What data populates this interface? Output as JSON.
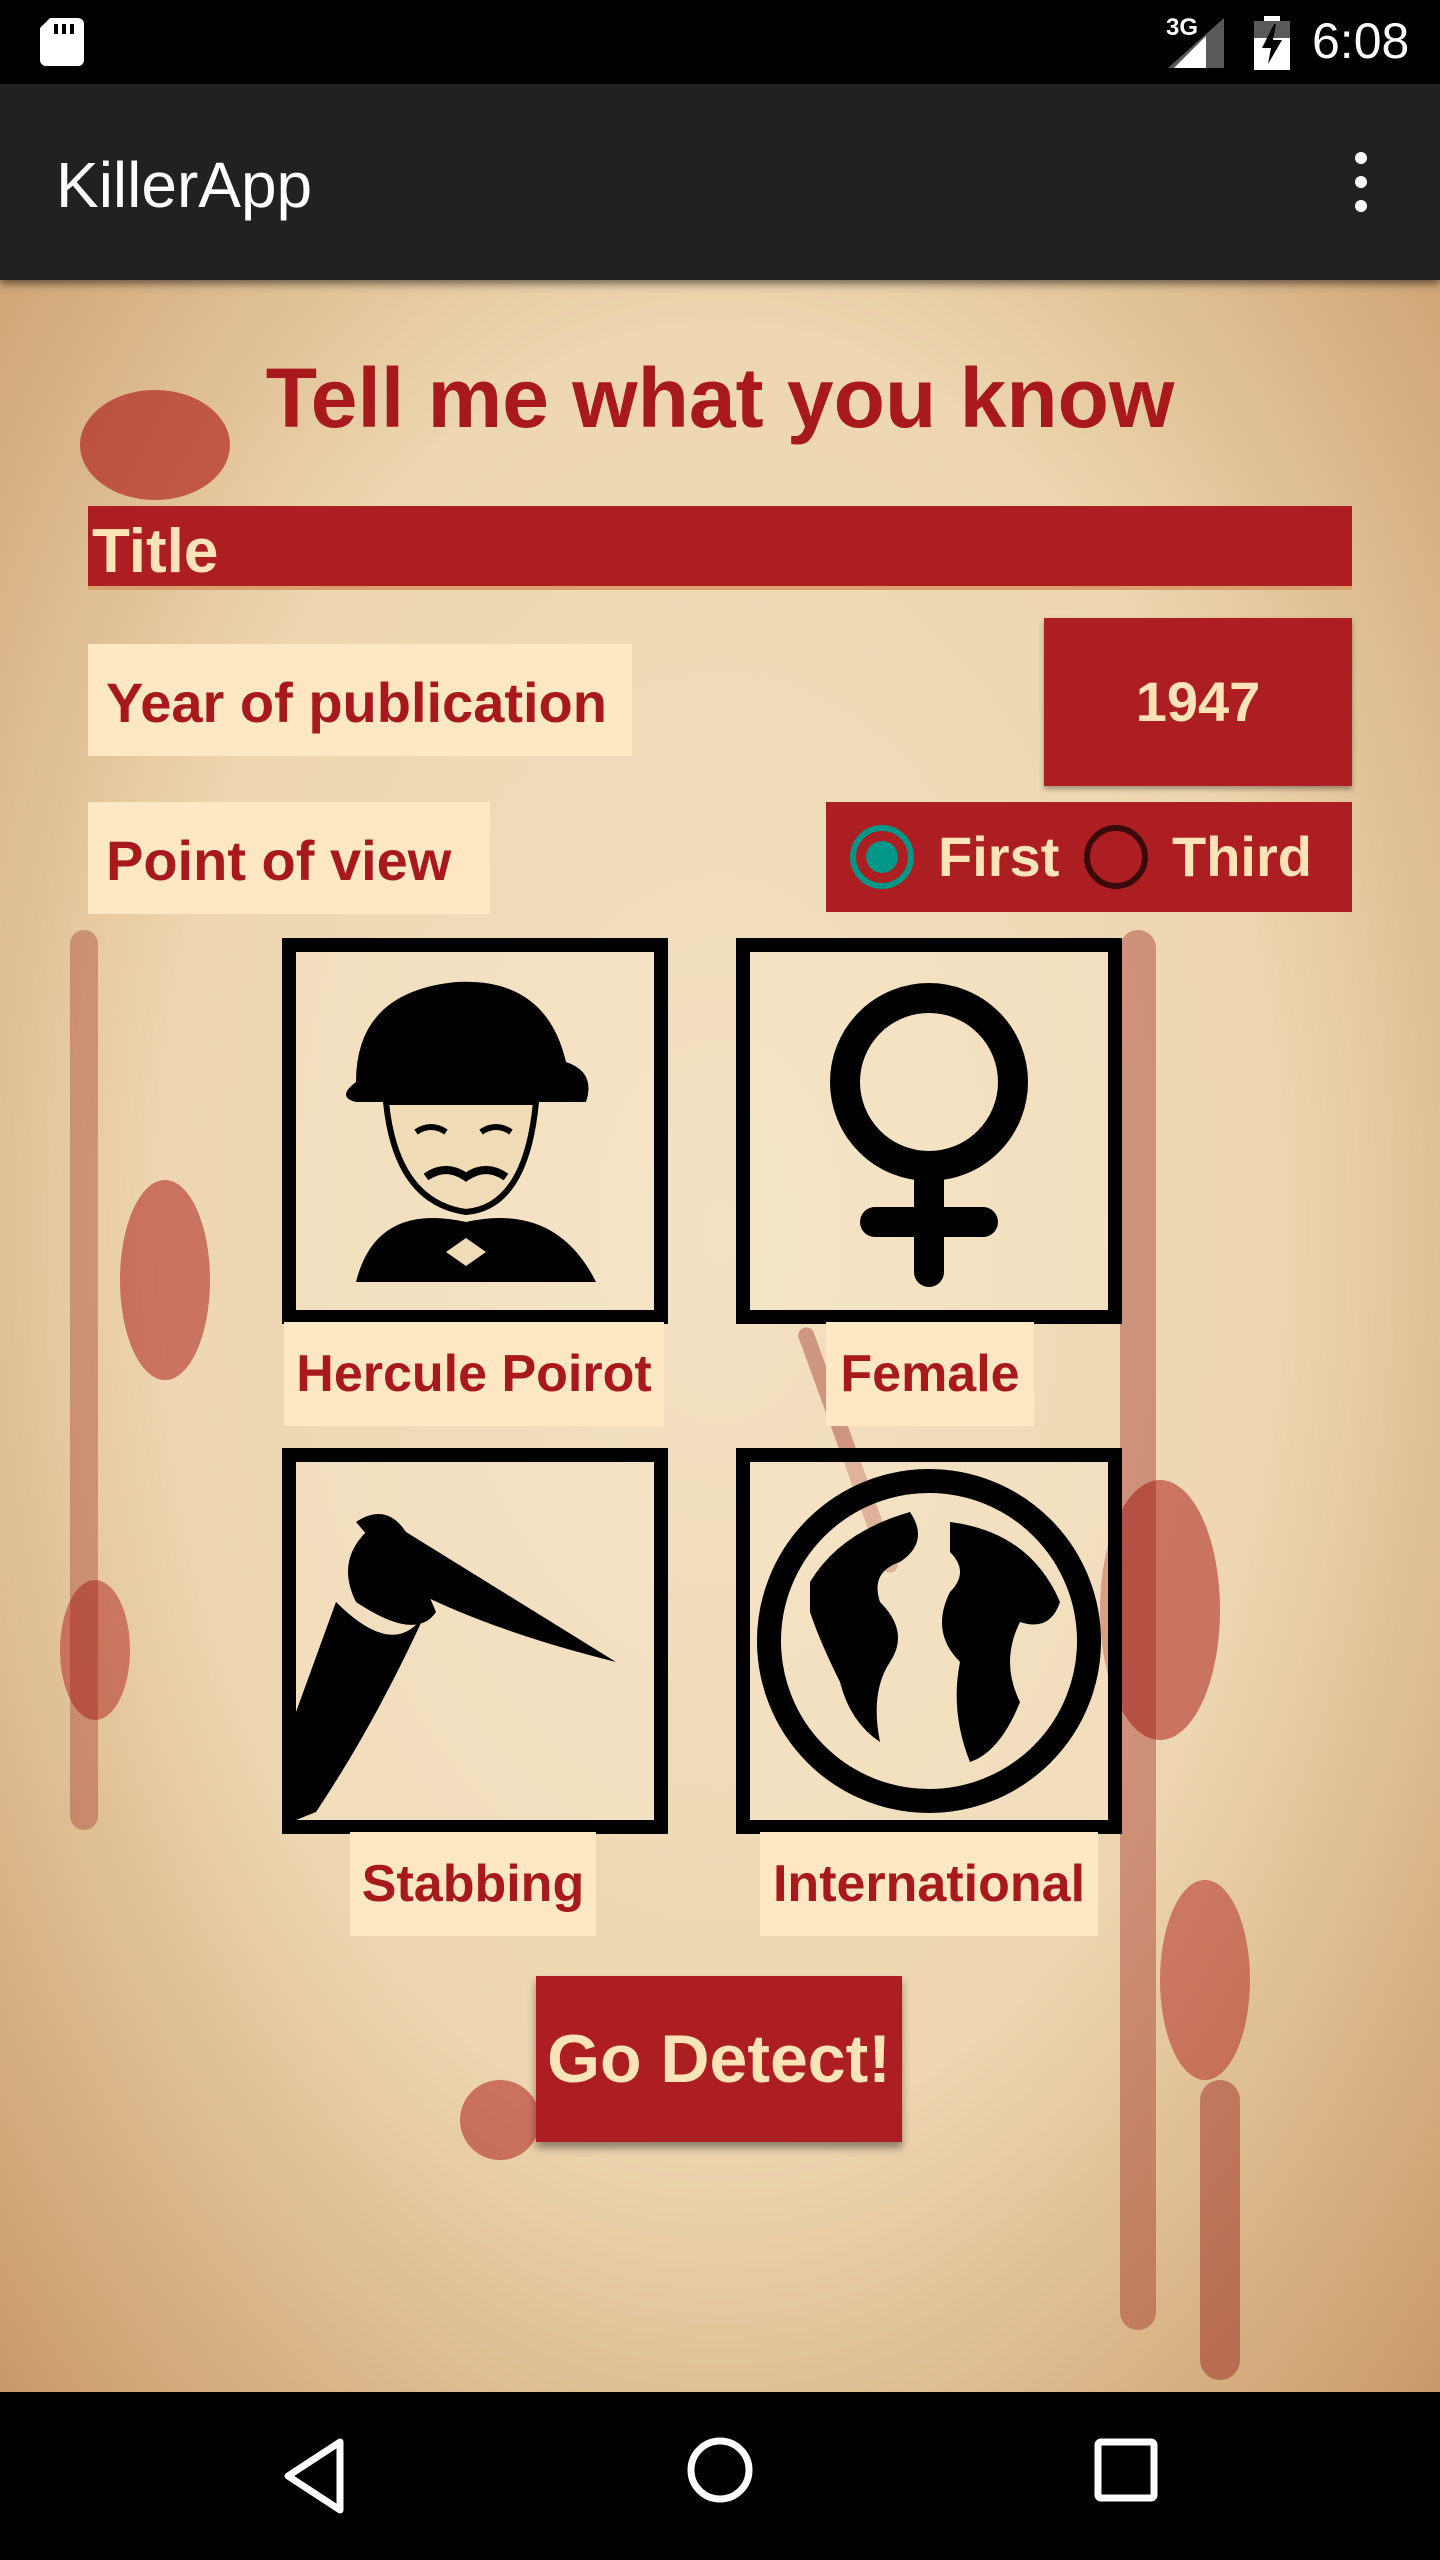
{
  "status_bar": {
    "network": "3G",
    "time": "6:08"
  },
  "app_bar": {
    "title": "KillerApp",
    "overflow_icon": "more-vert-icon"
  },
  "form": {
    "heading": "Tell me what you know",
    "title_field": {
      "value": "Title"
    },
    "year": {
      "label": "Year of publication",
      "value": "1947"
    },
    "point_of_view": {
      "label": "Point of view",
      "options": [
        "First",
        "Third"
      ],
      "selected": "First"
    },
    "tiles": [
      {
        "icon": "detective-icon",
        "caption": "Hercule Poirot"
      },
      {
        "icon": "female-symbol-icon",
        "caption": "Female"
      },
      {
        "icon": "knife-icon",
        "caption": "Stabbing"
      },
      {
        "icon": "globe-icon",
        "caption": "International"
      }
    ],
    "submit_label": "Go Detect!"
  },
  "colors": {
    "accent": "#ad1e22",
    "label_bg": "#fde8c3",
    "radio_checked": "#009688",
    "app_bar": "#212121"
  }
}
